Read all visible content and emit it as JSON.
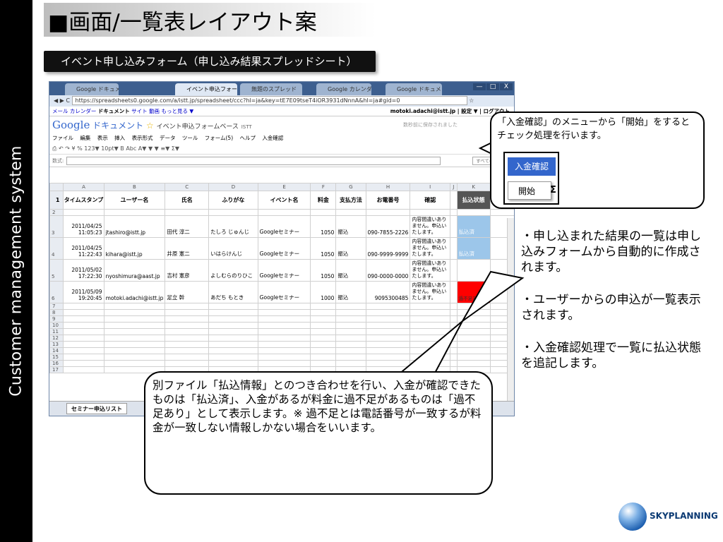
{
  "sidebar": {
    "text": "Customer management system"
  },
  "slide": {
    "title": "■画面/一覧表レイアウト案",
    "subtitle": "イベント申し込みフォーム（申し込み結果スプレッドシート）"
  },
  "browser": {
    "tabs": [
      "Google ドキュメント",
      "イベント申込フォーム",
      "無題のスプレッド",
      "Google カレンダー",
      "Google ドキュメント"
    ],
    "url": "https://spreadsheets0.google.com/a/istt.jp/spreadsheet/ccc?hl=ja&key=tE7E09tseT4iOR3931dNnnA&hl=ja#gid=0",
    "window_buttons": [
      "—",
      "□",
      "X"
    ]
  },
  "gbar": {
    "links": [
      "メール",
      "カレンダー",
      "ドキュメント",
      "サイト",
      "動画",
      "もっと見る ▼"
    ],
    "user": "motoki.adachi@istt.jp",
    "settings": "設定 ▼",
    "logout": "ログアウト"
  },
  "doc": {
    "logo": "Google",
    "app": "ドキュメント",
    "doc_title": "イベント申込フォームベース",
    "domain": "ISTT",
    "saved": "数秒前に保存されました"
  },
  "menu": [
    "ファイル",
    "編集",
    "表示",
    "挿入",
    "表示形式",
    "データ",
    "ツール",
    "フォーム(5)",
    "ヘルプ",
    "入金確認"
  ],
  "toolbar": "¥ % 123▼ 10pt▼ B Abc A▼ ▼ ▼ ≡▼ Σ▼",
  "formula": {
    "label": "数式:",
    "button": "すべての数式を"
  },
  "sheet": {
    "columns": [
      "A",
      "B",
      "C",
      "D",
      "E",
      "F",
      "G",
      "H",
      "I",
      "J",
      "K"
    ],
    "headers": [
      "タイムスタンプ",
      "ユーザー名",
      "氏名",
      "ふりがな",
      "イベント名",
      "料金",
      "支払方法",
      "お電番号",
      "確認",
      "",
      "払込状態"
    ],
    "rows": [
      {
        "rn": "3",
        "date": "2011/04/25",
        "time": "11:05:23",
        "user": "jtashiro@istt.jp",
        "name": "田代 淳二",
        "kana": "たしろ じゅんじ",
        "event": "Googleセミナー",
        "fee": "1050",
        "pay": "振込",
        "tel": "090-7855-2226",
        "confirm": "内容間違いありません。申込いたします。",
        "status": "払込済"
      },
      {
        "rn": "4",
        "date": "2011/04/25",
        "time": "11:22:43",
        "user": "kihara@istt.jp",
        "name": "井原 憲二",
        "kana": "いはらけんじ",
        "event": "Googleセミナー",
        "fee": "1050",
        "pay": "振込",
        "tel": "090-9999-9999",
        "confirm": "内容間違いありません。申込いたします。",
        "status": "払込済"
      },
      {
        "rn": "5",
        "date": "2011/05/02",
        "time": "17:22:30",
        "user": "nyoshimura@aast.jp",
        "name": "吉村 憲彦",
        "kana": "よしむらのりひこ",
        "event": "Googleセミナー",
        "fee": "1050",
        "pay": "振込",
        "tel": "090-0000-0000",
        "confirm": "内容間違いありません。申込いたします。",
        "status": ""
      },
      {
        "rn": "6",
        "date": "2011/05/09",
        "time": "19:20:45",
        "user": "motoki.adachi@istt.jp",
        "name": "足立 幹",
        "kana": "あだち もとき",
        "event": "Googleセミナー",
        "fee": "1000",
        "pay": "振込",
        "tel": "9095300485",
        "confirm": "内容間違いありません。申込いたします。",
        "status": "過不足あり"
      }
    ],
    "empty_rows": [
      "7",
      "8",
      "9",
      "10",
      "11",
      "12",
      "13",
      "14",
      "15",
      "16",
      "17"
    ],
    "tab_name": "セミナー申込リスト"
  },
  "callout_top": "「入金確認」のメニューから「開始」をするとチェック処理を行います。",
  "popup": {
    "item1": "入金確認",
    "item2": "開始",
    "sigma": "Σ"
  },
  "bullets": [
    "・申し込まれた結果の一覧は申し込みフォームから自動的に作成されます。",
    "・ユーザーからの申込が一覧表示されます。",
    "・入金確認処理で一覧に払込状態を追記します。"
  ],
  "callout_bottom": "別ファイル「払込情報」とのつき合わせを行い、入金が確認できたものは「払込済」、入金があるが料金に過不足があるものは「過不足あり」として表示します。※ 過不足とは電話番号が一致するが料金が一致しない情報しかない場合をいいます。",
  "logo": {
    "name": "SKYPLANNING"
  },
  "colors": {
    "status_ok": "#9cc6ea",
    "status_ng": "#ff0000",
    "accent": "#3366cc"
  }
}
